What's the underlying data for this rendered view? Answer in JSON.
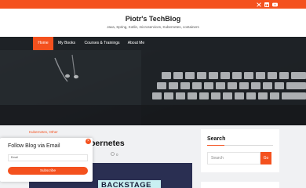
{
  "topbar": {
    "accent": "#f4511e",
    "social": [
      {
        "icon": "x-twitter-icon"
      },
      {
        "icon": "linkedin-icon"
      },
      {
        "icon": "youtube-icon"
      }
    ]
  },
  "header": {
    "title": "Piotr's TechBlog",
    "tagline": "Java, Spring, Kotlin, microservices, Kubernetes, containers"
  },
  "nav": {
    "items": [
      {
        "label": "Home",
        "active": true
      },
      {
        "label": "My Books",
        "active": false
      },
      {
        "label": "Courses & Trainings",
        "active": false
      },
      {
        "label": "About Me",
        "active": false
      }
    ]
  },
  "post": {
    "categories": "Kubernetes, Other",
    "title_partial": "bernetes",
    "comments": "0",
    "image_text": "BACKSTAGE"
  },
  "sidebar": {
    "search_title": "Search",
    "search_placeholder": "Search",
    "search_button": "Go"
  },
  "follow": {
    "title": "Follow Blog via Email",
    "close": "×",
    "email_placeholder": "Email",
    "subscribe_label": "Subscribe"
  }
}
